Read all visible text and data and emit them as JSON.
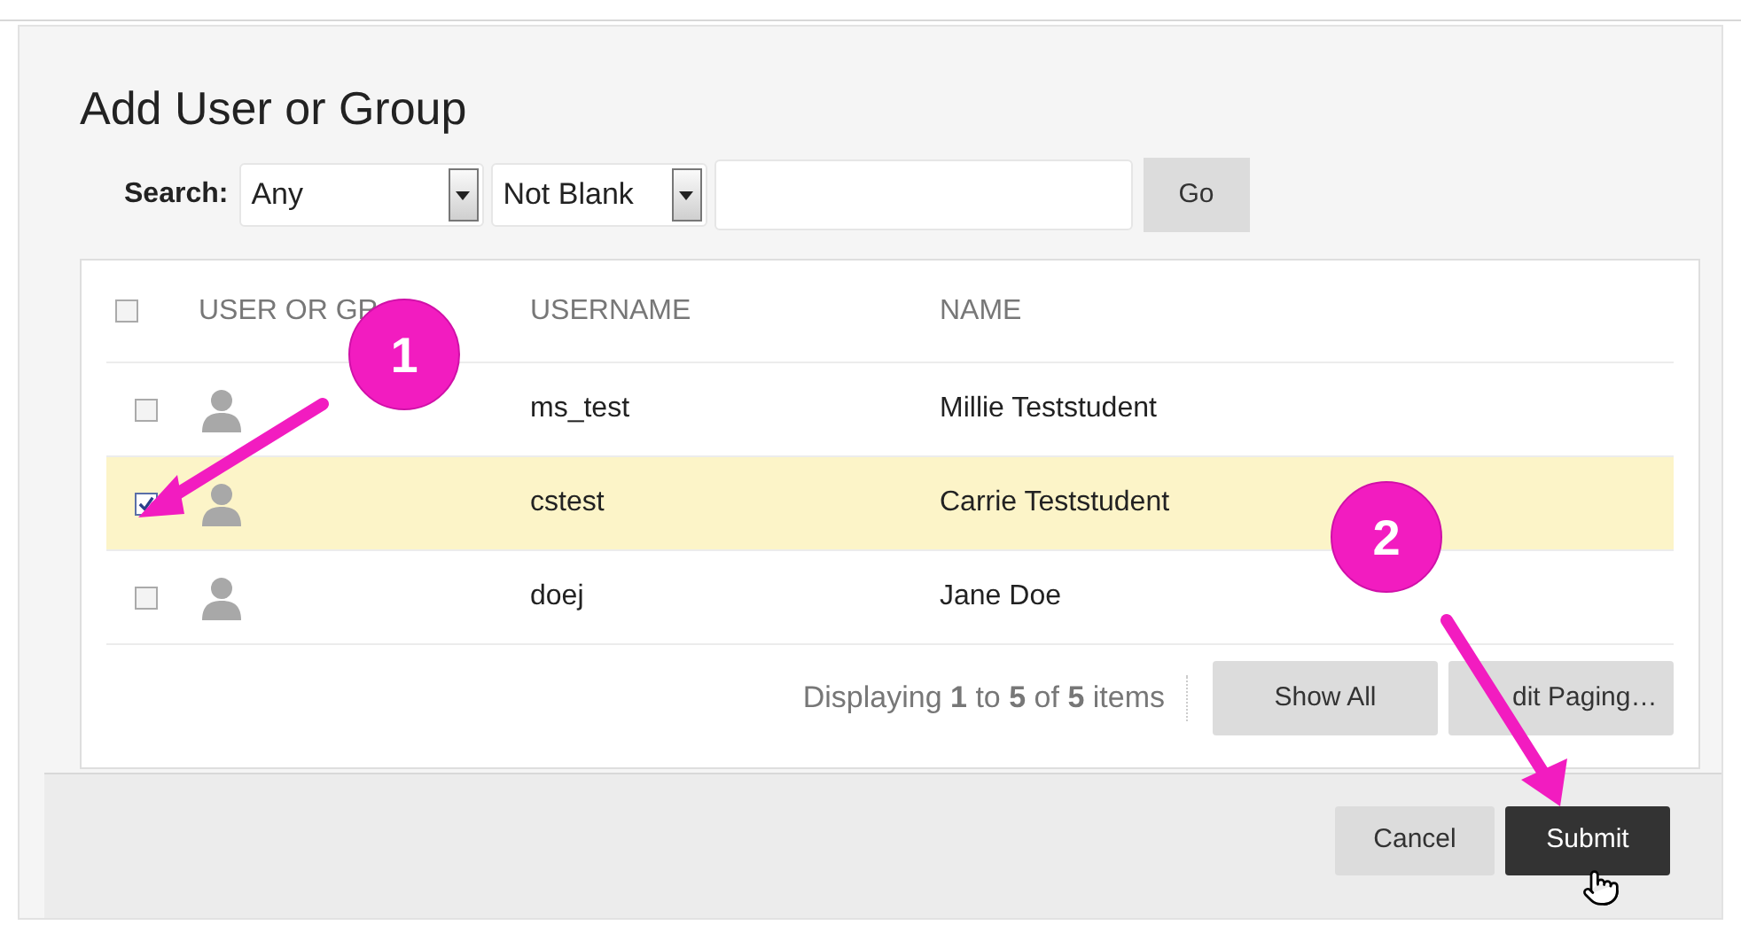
{
  "dialog": {
    "title": "Add User or Group"
  },
  "search": {
    "label": "Search:",
    "field_select": "Any",
    "operator_select": "Not Blank",
    "go_button": "Go"
  },
  "table": {
    "select_all_checked": false,
    "columns": [
      "USER OR GR",
      "USERNAME",
      "NAME"
    ],
    "rows": [
      {
        "username": "ms_test",
        "name": "Millie Teststudent",
        "selected": false
      },
      {
        "username": "cstest",
        "name": "Carrie Teststudent",
        "selected": true
      },
      {
        "username": "doej",
        "name": "Jane Doe",
        "selected": false
      }
    ],
    "paging": {
      "text": "Displaying **1** to **5** of **5** items",
      "buttons": [
        "Show All",
        "dit Paging…"
      ]
    }
  },
  "actions": [
    "Cancel",
    "Submit"
  ],
  "annotations": [
    {
      "label": "1"
    },
    {
      "label": "2"
    }
  ]
}
